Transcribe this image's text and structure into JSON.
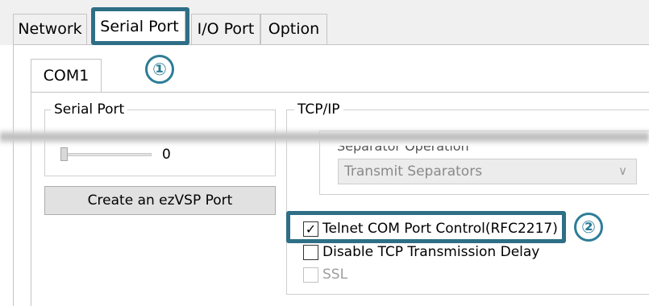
{
  "tabs": [
    {
      "label": "Network"
    },
    {
      "label": "Serial Port"
    },
    {
      "label": "I/O Port"
    },
    {
      "label": "Option"
    }
  ],
  "markers": {
    "one": "①",
    "two": "②"
  },
  "subtab": {
    "label": "COM1"
  },
  "serial_group": {
    "title": "Serial Port",
    "slider_value": "0",
    "slider_level": 0,
    "create_button": "Create an ezVSP Port"
  },
  "tcpip_group": {
    "title": "TCP/IP",
    "separator_label_partial": "Separator Operation",
    "separator_select": "Transmit Separators",
    "options": [
      {
        "label": "Telnet COM Port Control(RFC2217)",
        "checked": true,
        "enabled": true
      },
      {
        "label": "Disable TCP Transmission Delay",
        "checked": false,
        "enabled": true
      },
      {
        "label": "SSL",
        "checked": false,
        "enabled": false
      }
    ]
  },
  "colors": {
    "highlight": "#2e6f86",
    "marker": "#2e7d96"
  },
  "icons": {
    "check": "check-icon",
    "dropdown": "chevron-down-icon"
  }
}
